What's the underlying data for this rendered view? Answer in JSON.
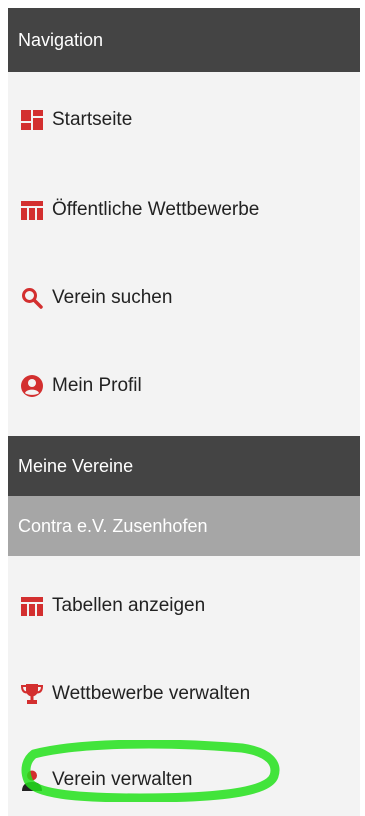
{
  "navigation": {
    "header": "Navigation",
    "items": [
      {
        "label": "Startseite",
        "icon": "dashboard-icon"
      },
      {
        "label": "Öffentliche Wettbewerbe",
        "icon": "table-icon"
      },
      {
        "label": "Verein suchen",
        "icon": "search-icon"
      },
      {
        "label": "Mein Profil",
        "icon": "user-circle-icon"
      }
    ]
  },
  "my_clubs": {
    "header": "Meine Vereine",
    "club_name": "Contra e.V. Zusenhofen",
    "items": [
      {
        "label": "Tabellen anzeigen",
        "icon": "table-icon"
      },
      {
        "label": "Wettbewerbe verwalten",
        "icon": "trophy-icon"
      },
      {
        "label": "Verein verwalten",
        "icon": "user-icon"
      }
    ]
  },
  "colors": {
    "accent": "#d32f2f",
    "header_bg": "#444444",
    "subheader_bg": "#a6a6a6",
    "panel_bg": "#f3f3f3",
    "highlight": "#22e01a"
  }
}
